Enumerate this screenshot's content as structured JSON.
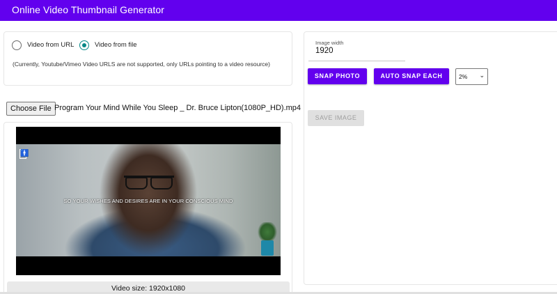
{
  "app": {
    "title": "Online Video Thumbnail Generator"
  },
  "source": {
    "options": [
      "Video from URL",
      "Video from file"
    ],
    "selected": "Video from file",
    "note": "(Currently, Youtube/Vimeo Video URLS are not supported, only URLs pointing to a video resource)"
  },
  "file_input": {
    "button_label": "Choose File",
    "file_name": "Program Your Mind While You Sleep _ Dr. Bruce Lipton(1080P_HD).mp4"
  },
  "video": {
    "caption": "SO YOUR WISHES AND DESIRES ARE IN YOUR CONSCIOUS MIND",
    "size_text": "Video size: 1920x1080"
  },
  "controls": {
    "image_width_label": "Image width",
    "image_width_value": "1920",
    "snap_photo_label": "SNAP PHOTO",
    "auto_snap_label": "AUTO SNAP EACH",
    "interval_selected": "2%",
    "save_image_label": "SAVE IMAGE"
  },
  "colors": {
    "primary": "#6200ee",
    "radio_checked": "#018786",
    "disabled_bg": "#e0e0e0"
  },
  "icons": {
    "dropdown": "chevron-down-icon",
    "watermark": "person-logo-icon"
  }
}
